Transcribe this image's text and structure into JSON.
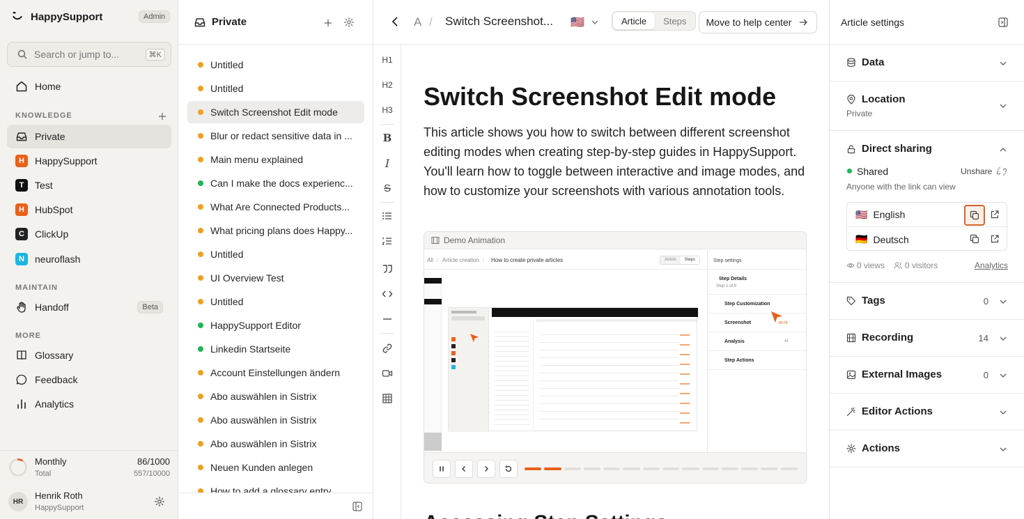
{
  "sidebar": {
    "brand": "HappySupport",
    "role_badge": "Admin",
    "search_placeholder": "Search or jump to...",
    "search_shortcut": "⌘K",
    "home": "Home",
    "knowledge_header": "KNOWLEDGE",
    "knowledge": [
      {
        "label": "Private",
        "letter": "",
        "color": ""
      },
      {
        "label": "HappySupport",
        "letter": "H",
        "color": "#e8611a"
      },
      {
        "label": "Test",
        "letter": "T",
        "color": "#111111"
      },
      {
        "label": "HubSpot",
        "letter": "H",
        "color": "#e8611a"
      },
      {
        "label": "ClickUp",
        "letter": "C",
        "color": "#222222"
      },
      {
        "label": "neuroflash",
        "letter": "N",
        "color": "#1cb6e0"
      }
    ],
    "maintain_header": "MAINTAIN",
    "handoff": "Handoff",
    "handoff_badge": "Beta",
    "more_header": "MORE",
    "more": [
      "Glossary",
      "Feedback",
      "Analytics"
    ],
    "plan_label": "Monthly",
    "plan_sub": "Total",
    "plan_used": "86/1000",
    "plan_total": "557/10000",
    "plan_fraction": 0.086,
    "user_initials": "HR",
    "user_name": "Henrik Roth",
    "user_org": "HappySupport"
  },
  "list": {
    "title": "Private",
    "items": [
      {
        "label": "Untitled",
        "status": "orange"
      },
      {
        "label": "Untitled",
        "status": "orange"
      },
      {
        "label": "Switch Screenshot Edit mode",
        "status": "orange"
      },
      {
        "label": "Blur or redact sensitive data in ...",
        "status": "orange"
      },
      {
        "label": "Main menu explained",
        "status": "orange"
      },
      {
        "label": "Can I make the docs experienc...",
        "status": "green"
      },
      {
        "label": "What Are Connected Products...",
        "status": "orange"
      },
      {
        "label": "What pricing plans does Happy...",
        "status": "orange"
      },
      {
        "label": "Untitled",
        "status": "orange"
      },
      {
        "label": "UI Overview Test",
        "status": "orange"
      },
      {
        "label": "Untitled",
        "status": "orange"
      },
      {
        "label": "HappySupport Editor",
        "status": "green"
      },
      {
        "label": "Linkedin Startseite",
        "status": "green"
      },
      {
        "label": "Account Einstellungen ändern",
        "status": "orange"
      },
      {
        "label": "Abo auswählen in Sistrix",
        "status": "orange"
      },
      {
        "label": "Abo auswählen in Sistrix",
        "status": "orange"
      },
      {
        "label": "Abo auswählen in Sistrix",
        "status": "orange"
      },
      {
        "label": "Neuen Kunden anlegen",
        "status": "orange"
      },
      {
        "label": "How to add a glossary entry",
        "status": "orange"
      }
    ]
  },
  "topbar": {
    "crumb_root": "A",
    "crumb_title": "Switch Screenshot...",
    "flag": "🇺🇸",
    "tab_article": "Article",
    "tab_steps": "Steps",
    "move_button": "Move to help center"
  },
  "toolbar": [
    "H1",
    "H2",
    "H3",
    "B",
    "I",
    "S"
  ],
  "article": {
    "title": "Switch Screenshot Edit mode",
    "lead": "This article shows you how to switch between different screenshot editing modes when creating step-by-step guides in HappySupport. You'll learn how to toggle between interactive and image modes, and how to customize your screenshots with various annotation tools.",
    "demo_label": "Demo Animation",
    "next_heading": "Accessing Step Settings"
  },
  "demo": {
    "crumb_all": "All",
    "crumb_section": "Article creation",
    "crumb_title": "How to create private articles",
    "tab_article": "Article",
    "tab_steps": "Steps",
    "settings_title": "Step settings",
    "step_details": "Step Details",
    "step_of": "Step 1 of 9",
    "step_custom": "Step Customization",
    "screenshot": "Screenshot",
    "beta": "BETA",
    "analysis": "Analysis",
    "ai": "AI",
    "step_actions": "Step Actions",
    "progress_total": 14,
    "progress_done": 2
  },
  "panel": {
    "title": "Article settings",
    "data": "Data",
    "location": "Location",
    "location_value": "Private",
    "sharing": "Direct sharing",
    "shared": "Shared",
    "unshare": "Unshare",
    "link_note": "Anyone with the link can view",
    "languages": [
      {
        "flag": "🇺🇸",
        "label": "English"
      },
      {
        "flag": "🇩🇪",
        "label": "Deutsch"
      }
    ],
    "views": "0 views",
    "visitors": "0 visitors",
    "analytics_link": "Analytics",
    "tags": "Tags",
    "tags_count": "0",
    "recording": "Recording",
    "recording_count": "14",
    "external_images": "External Images",
    "external_count": "0",
    "editor_actions": "Editor Actions",
    "actions": "Actions"
  }
}
